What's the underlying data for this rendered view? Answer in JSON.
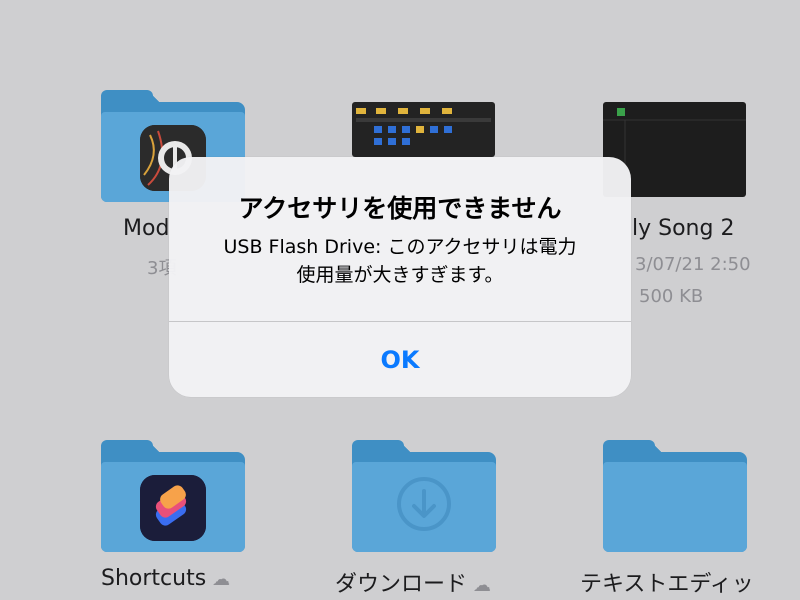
{
  "files": [
    {
      "name": "Mod",
      "meta1": "3項",
      "type": "folder-app"
    },
    {
      "name": "",
      "meta1": "",
      "meta2": "",
      "type": "document-thumb"
    },
    {
      "name": "ly Song 2",
      "meta1": "3/07/21 2:50",
      "meta2": "500 KB",
      "type": "document-thumb-dark"
    },
    {
      "name": "Shortcuts",
      "type": "folder-app",
      "icon": "cloud-download-icon"
    },
    {
      "name": "ダウンロード",
      "type": "folder-download",
      "icon": "cloud-download-icon"
    },
    {
      "name": "テキストエディッ",
      "type": "folder"
    }
  ],
  "alert": {
    "title": "アクセサリを使用できません",
    "message_line1": "USB Flash Drive: このアクセサリは電力",
    "message_line2": "使用量が大きすぎます。",
    "ok_label": "OK"
  },
  "colors": {
    "folder_back": "#3f8fc4",
    "folder_front": "#5aa6d8",
    "accent": "#0a7aff",
    "background": "#cfcfd1"
  }
}
